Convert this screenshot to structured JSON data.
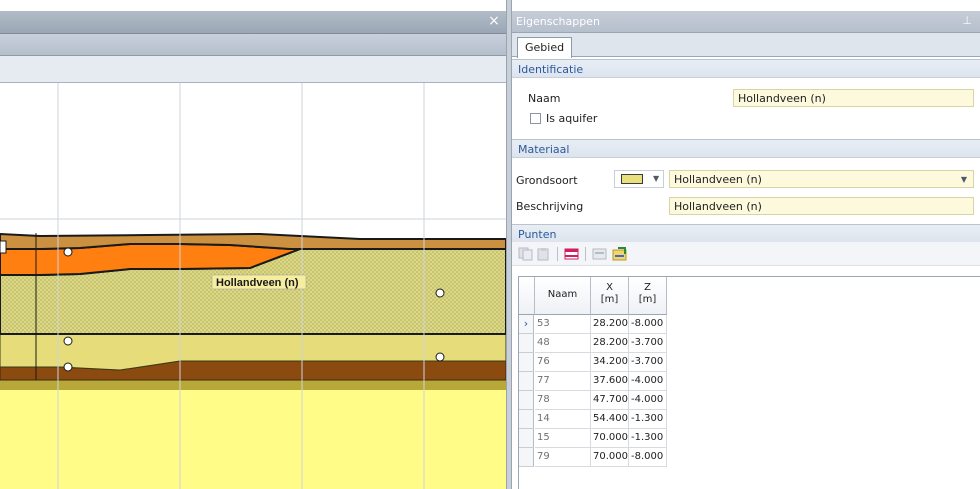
{
  "canvas": {
    "close_glyph": "×",
    "layer_label": "Hollandveen (n)",
    "colors": {
      "orange": "#ff8010",
      "tan": "#cc9140",
      "hatched": "#dcd88a",
      "lightyellow": "#efe48c",
      "brown": "#8a4a10",
      "bottom": "#fffd88"
    }
  },
  "panel": {
    "title": "Eigenschappen",
    "pin_glyph": "ᵖ",
    "tab": "Gebied",
    "identificatie": {
      "header": "Identificatie",
      "naam_label": "Naam",
      "naam_value": "Hollandveen (n)",
      "aquifer_label": "Is aquifer",
      "aquifer_checked": false
    },
    "materiaal": {
      "header": "Materiaal",
      "grondsoort_label": "Grondsoort",
      "grondsoort_color": "#e7e07c",
      "grondsoort_value": "Hollandveen (n)",
      "beschrijving_label": "Beschrijving",
      "beschrijving_value": "Hollandveen (n)"
    },
    "punten": {
      "header": "Punten",
      "columns": {
        "naam": "Naam",
        "x": "X",
        "x_unit": "[m]",
        "z": "Z",
        "z_unit": "[m]"
      },
      "rows": [
        {
          "naam": "53",
          "x": "28.200",
          "z": "-8.000",
          "current": true
        },
        {
          "naam": "48",
          "x": "28.200",
          "z": "-3.700",
          "current": false
        },
        {
          "naam": "76",
          "x": "34.200",
          "z": "-3.700",
          "current": false
        },
        {
          "naam": "77",
          "x": "37.600",
          "z": "-4.000",
          "current": false
        },
        {
          "naam": "78",
          "x": "47.700",
          "z": "-4.000",
          "current": false
        },
        {
          "naam": "14",
          "x": "54.400",
          "z": "-1.300",
          "current": false
        },
        {
          "naam": "15",
          "x": "70.000",
          "z": "-1.300",
          "current": false
        },
        {
          "naam": "79",
          "x": "70.000",
          "z": "-8.000",
          "current": false
        }
      ]
    }
  }
}
